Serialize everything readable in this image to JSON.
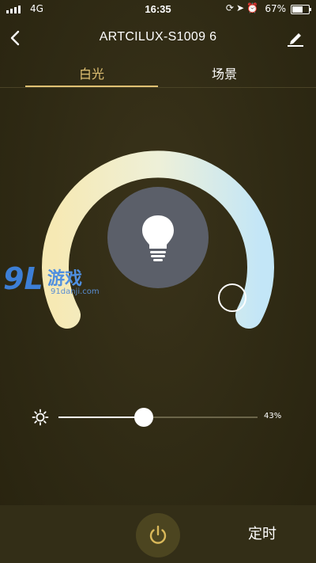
{
  "status_bar": {
    "network": "4G",
    "time": "16:35",
    "battery_percent": "67%",
    "battery_level": 0.67,
    "icons": [
      "rotation-lock-icon",
      "location-icon",
      "alarm-icon"
    ]
  },
  "nav": {
    "title": "ARTCILUX-S1009 6",
    "back_icon": "back-arrow-icon",
    "edit_icon": "edit-icon"
  },
  "tabs": [
    {
      "label": "白光",
      "active": true
    },
    {
      "label": "场景",
      "active": false
    }
  ],
  "color_temperature": {
    "warm_color": "#f5e7b0",
    "cool_color": "#c6e8f6",
    "bulb_icon": "bulb-icon"
  },
  "watermark": {
    "logo": "9L",
    "text": "游戏",
    "url": "91danji.com"
  },
  "brightness": {
    "value": 0.43,
    "label": "43%",
    "icon": "sun-icon"
  },
  "bottom": {
    "power_icon": "power-icon",
    "timer_label": "定时"
  },
  "colors": {
    "accent": "#e0c173",
    "background": "#2f2a14",
    "bulb_circle": "#5b5f69"
  }
}
